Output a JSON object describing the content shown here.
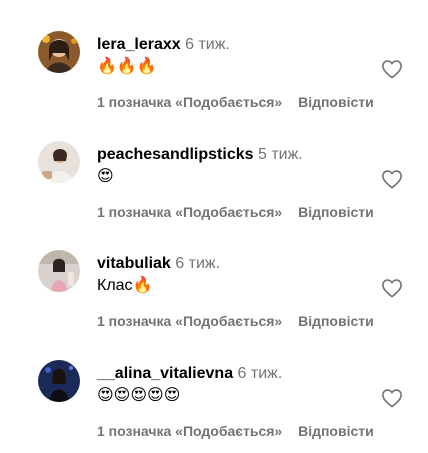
{
  "comments": [
    {
      "username": "lera_leraxx",
      "time": "6 тиж.",
      "text": "🔥🔥🔥",
      "likes": "1 позначка «Подобається»",
      "reply": "Відповісти"
    },
    {
      "username": "peachesandlipsticks",
      "time": "5 тиж.",
      "text": "😍",
      "likes": "1 позначка «Подобається»",
      "reply": "Відповісти"
    },
    {
      "username": "vitabuliak",
      "time": "6 тиж.",
      "text": "Клас🔥",
      "likes": "1 позначка «Подобається»",
      "reply": "Відповісти"
    },
    {
      "username": "__alina_vitalievna",
      "time": "6 тиж.",
      "text": "😍😍😍😍😍",
      "likes": "1 позначка «Подобається»",
      "reply": "Відповісти"
    }
  ],
  "icons": {
    "like": "heart-outline-icon"
  },
  "colors": {
    "muted_text": "#737373",
    "primary_text": "#000000"
  }
}
